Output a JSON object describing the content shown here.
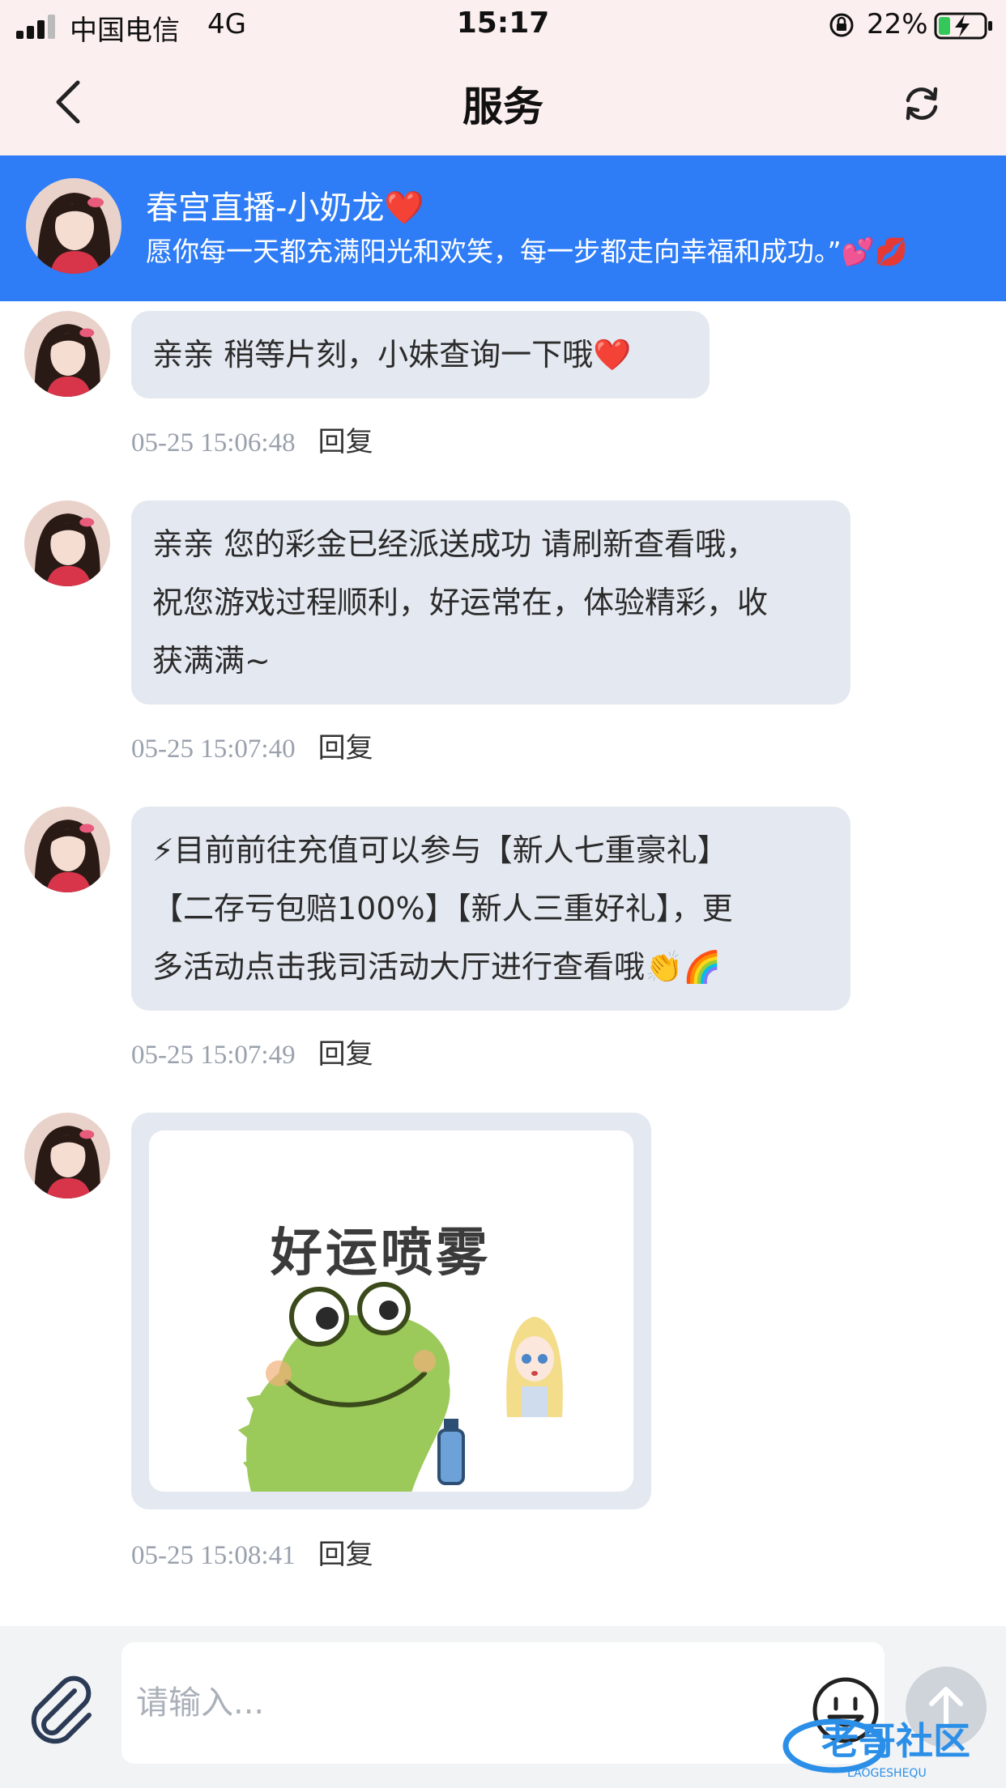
{
  "status_bar": {
    "carrier": "中国电信",
    "network": "4G",
    "time": "15:17",
    "battery_percent": "22%"
  },
  "nav": {
    "title": "服务"
  },
  "agent": {
    "name": "春宫直播-小奶龙❤️",
    "motto": "愿你每一天都充满阳光和欢笑，每一步都走向幸福和成功。”💕💋"
  },
  "messages": [
    {
      "lines": [
        "亲亲  稍等片刻，小妹查询一下哦❤️"
      ],
      "time": "05-25 15:06:48",
      "reply_label": "回复"
    },
    {
      "lines": [
        "亲亲 您的彩金已经派送成功 请刷新查看哦，",
        "祝您游戏过程顺利，好运常在，体验精彩，收",
        "获满满~"
      ],
      "time": "05-25 15:07:40",
      "reply_label": "回复"
    },
    {
      "lines": [
        " ⚡目前前往充值可以参与【新人七重豪礼】",
        "【二存亏包赔100%】【新人三重好礼】，更",
        "多活动点击我司活动大厅进行查看哦👏🌈"
      ],
      "time": "05-25 15:07:49",
      "reply_label": "回复"
    },
    {
      "sticker_text": "好运喷雾",
      "time": "05-25 15:08:41",
      "reply_label": "回复"
    }
  ],
  "input": {
    "placeholder": "请输入..."
  },
  "watermark": {
    "text": "老哥社区",
    "subtext": "LAOGESHEQU"
  }
}
